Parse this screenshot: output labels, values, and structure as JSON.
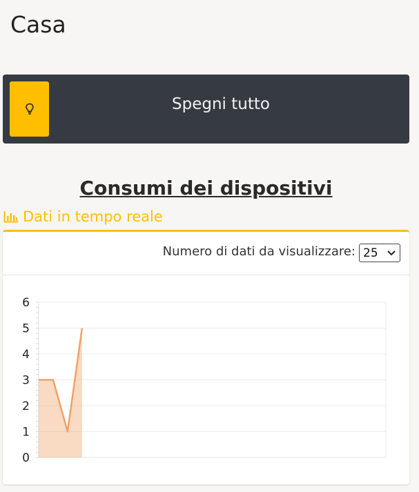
{
  "header": {
    "title": "Casa"
  },
  "off_bar": {
    "label": "Spegni tutto",
    "icon": "lightbulb-icon",
    "accent": "#ffbf00",
    "bg": "#363a43"
  },
  "section": {
    "title": "Consumi dei dispositivi"
  },
  "realtime": {
    "label": "Dati in tempo reale",
    "icon": "bar-chart-icon"
  },
  "controls": {
    "count_label": "Numero di dati da visualizzare:",
    "count_value": "25"
  },
  "chart_data": {
    "type": "area",
    "x": [
      0,
      1,
      2,
      3
    ],
    "series": [
      {
        "values": [
          3,
          3,
          1,
          5
        ],
        "color": "#f0a266"
      }
    ],
    "yticks": [
      "0",
      "1",
      "2",
      "3",
      "4",
      "5",
      "6"
    ],
    "ylim": [
      0,
      6
    ],
    "xlim": [
      0,
      24
    ],
    "grid": true
  }
}
